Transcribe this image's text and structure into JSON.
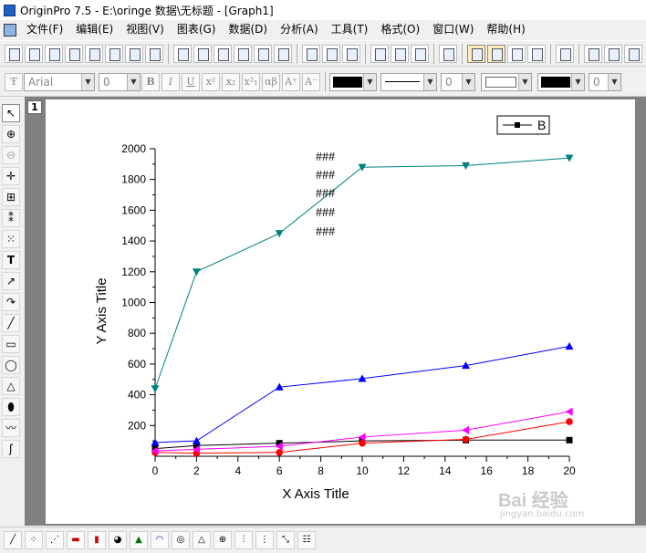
{
  "window": {
    "title": "OriginPro 7.5 - E:\\oringe 数据\\无标题 - [Graph1]"
  },
  "menu": [
    "文件(F)",
    "编辑(E)",
    "视图(V)",
    "图表(G)",
    "数据(D)",
    "分析(A)",
    "工具(T)",
    "格式(O)",
    "窗口(W)",
    "帮助(H)"
  ],
  "format_toolbar": {
    "font": "Arial",
    "size": "0",
    "bold": "B",
    "italic": "I",
    "underline": "U",
    "superscript": "x²",
    "subscript": "x₂",
    "supsub": "x²₁",
    "greek": "αβ",
    "increase": "A⁺",
    "decrease": "A⁻",
    "line_width": "0",
    "pattern_width": "0"
  },
  "layer": {
    "number": "1"
  },
  "watermark": {
    "brand": "Bai 经验",
    "url": "jingyan.baidu.com"
  },
  "chart_data": {
    "type": "line",
    "xlabel": "X Axis Title",
    "ylabel": "Y Axis Title",
    "xlim": [
      0,
      20
    ],
    "ylim": [
      0,
      2000
    ],
    "xticks": [
      "0",
      "2",
      "4",
      "6",
      "8",
      "10",
      "12",
      "14",
      "16",
      "18",
      "20"
    ],
    "yticks": [
      "200",
      "400",
      "600",
      "800",
      "1000",
      "1200",
      "1400",
      "1600",
      "1800",
      "2000"
    ],
    "legend": {
      "position": "top-right",
      "entries": [
        "B"
      ]
    },
    "annotation": [
      "###",
      "###",
      "###",
      "###",
      "###"
    ],
    "series": [
      {
        "name": "B",
        "color": "#000000",
        "marker": "square",
        "x": [
          0,
          2,
          6,
          10,
          15,
          20
        ],
        "y": [
          50,
          70,
          85,
          100,
          105,
          105
        ]
      },
      {
        "color": "#ff0000",
        "marker": "circle",
        "x": [
          0,
          2,
          6,
          10,
          15,
          20
        ],
        "y": [
          25,
          20,
          25,
          85,
          110,
          225
        ]
      },
      {
        "color": "#0000ff",
        "marker": "triangle-up",
        "x": [
          0,
          2,
          6,
          10,
          15,
          20
        ],
        "y": [
          90,
          100,
          450,
          505,
          590,
          715
        ]
      },
      {
        "color": "#008080",
        "marker": "triangle-down",
        "x": [
          0,
          2,
          6,
          10,
          15,
          20
        ],
        "y": [
          440,
          1200,
          1450,
          1880,
          1890,
          1940
        ]
      },
      {
        "color": "#ff00ff",
        "marker": "triangle-left",
        "x": [
          0,
          2,
          6,
          10,
          15,
          20
        ],
        "y": [
          35,
          45,
          65,
          125,
          170,
          290
        ]
      }
    ]
  }
}
